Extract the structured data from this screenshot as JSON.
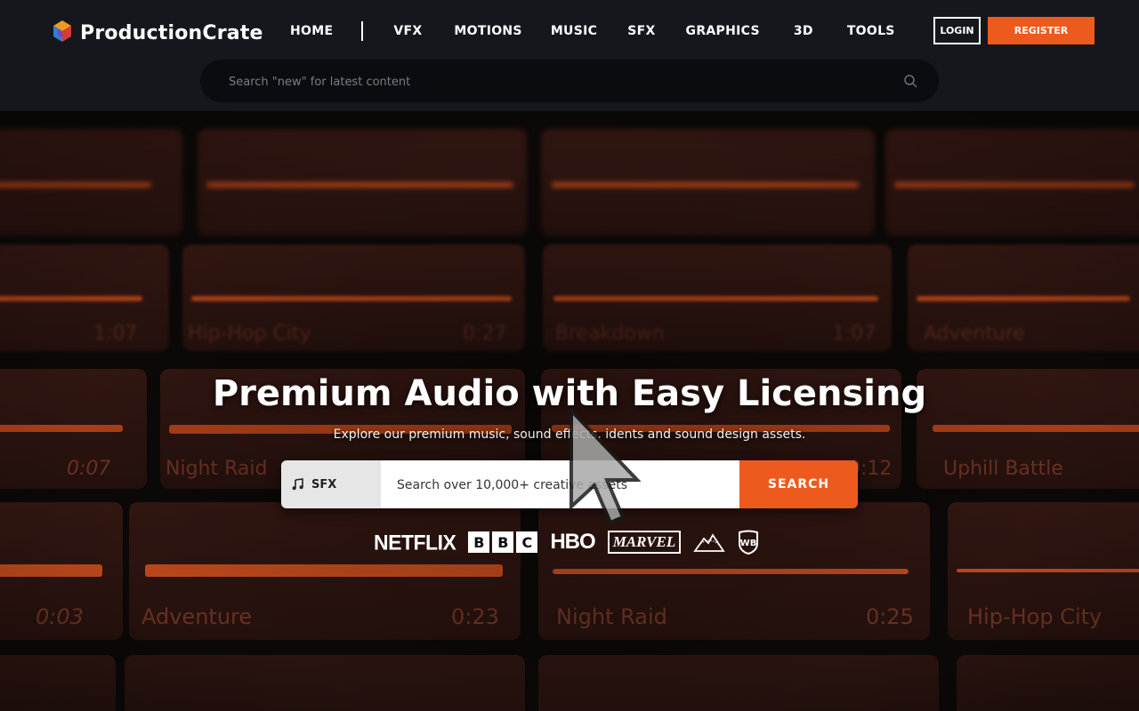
{
  "header": {
    "logo_text": "ProductionCrate",
    "nav": [
      "HOME",
      "VFX",
      "MOTIONS",
      "MUSIC",
      "SFX",
      "GRAPHICS",
      "3D",
      "TOOLS"
    ],
    "login_label": "LOGIN",
    "register_label": "REGISTER",
    "search_placeholder": "Search \"new\" for latest content"
  },
  "hero": {
    "title": "Premium Audio with Easy Licensing",
    "subtitle": "Explore our premium music, sound effects, idents and sound design assets.",
    "category": "SFX",
    "search_placeholder": "Search over 10,000+ creative assets",
    "search_button": "SEARCH",
    "brands": [
      "NETFLIX",
      "BBC",
      "HBO",
      "MARVEL",
      "Paramount",
      "WB"
    ],
    "bbc_letters": [
      "B",
      "B",
      "C"
    ]
  },
  "tracks": {
    "row1": [
      {
        "name": "",
        "duration": "1:07"
      },
      {
        "name": "Hip-Hop City",
        "duration": "0:27"
      },
      {
        "name": "Breakdown",
        "duration": "1:07"
      },
      {
        "name": "Adventure",
        "duration": ""
      }
    ],
    "row2": [
      {
        "name": "",
        "duration": "0:07"
      },
      {
        "name": "Night Raid",
        "duration": ""
      },
      {
        "name": "",
        "duration": "0:12"
      },
      {
        "name": "Uphill Battle",
        "duration": ""
      }
    ],
    "row3": [
      {
        "name": "",
        "duration": "0:03"
      },
      {
        "name": "Adventure",
        "duration": "0:23"
      },
      {
        "name": "Night Raid",
        "duration": "0:25"
      },
      {
        "name": "Hip-Hop City",
        "duration": ""
      }
    ]
  },
  "colors": {
    "accent": "#ee5a1e",
    "header_bg": "#15171c"
  },
  "icons": {
    "search": "search-icon",
    "music": "music-note-icon"
  }
}
